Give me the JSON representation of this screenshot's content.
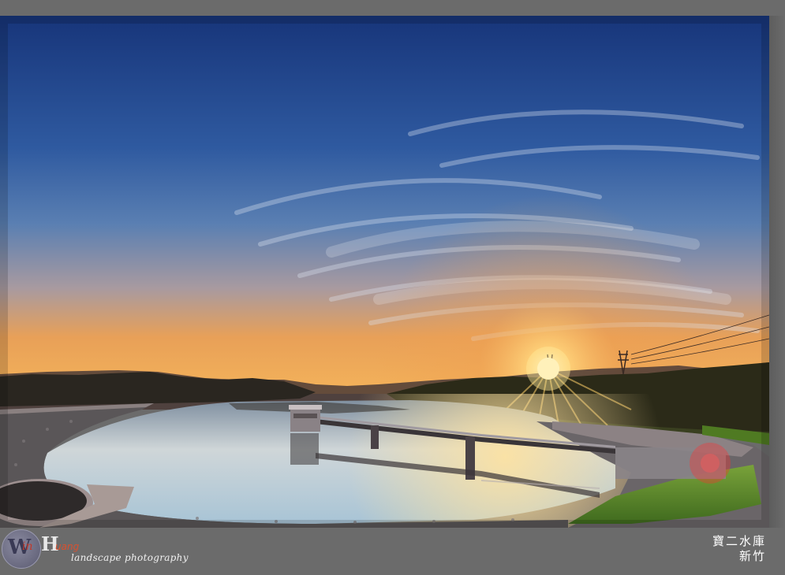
{
  "watermark": {
    "logo_w": "W",
    "logo_in": "in",
    "logo_h": "H",
    "logo_uang": "uang",
    "tagline": "landscape photography"
  },
  "caption": {
    "line1": "寶二水庫",
    "line2": "新竹"
  },
  "colors": {
    "sky_top": "#1b3f86",
    "sky_mid": "#3f6aa8",
    "sky_horizon": "#f0a24a",
    "sun": "#fff4c0",
    "water": "#c9d8df",
    "hills": "#2a2418",
    "grass": "#5e8a2a",
    "frame": "#6b6b6b"
  }
}
